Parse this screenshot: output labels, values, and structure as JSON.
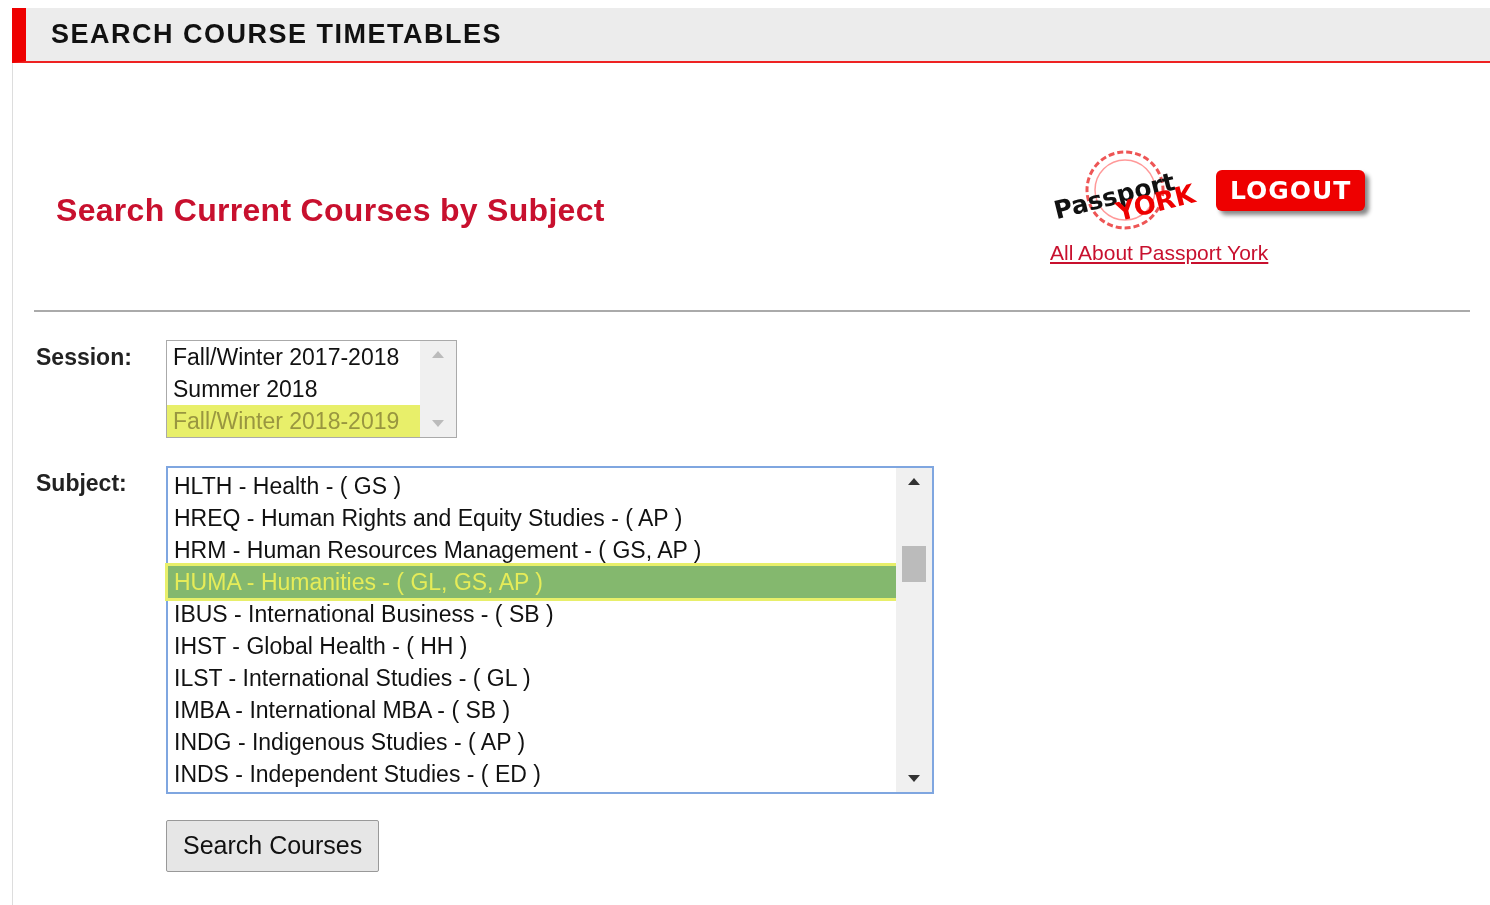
{
  "header": {
    "title": "SEARCH COURSE TIMETABLES"
  },
  "heading": "Search Current Courses by Subject",
  "logo": {
    "line_1": "Passport",
    "line_2": "YORK"
  },
  "logout_button": "LOGOUT",
  "info_link": "All About Passport York",
  "session": {
    "label": "Session:",
    "options": [
      {
        "text": "Fall/Winter 2017-2018",
        "selected": false
      },
      {
        "text": "Summer 2018",
        "selected": false
      },
      {
        "text": "Fall/Winter 2018-2019",
        "selected": true
      }
    ]
  },
  "subject": {
    "label": "Subject:",
    "options": [
      {
        "text": "HLTH - Health - ( GS )",
        "selected": false
      },
      {
        "text": "HREQ - Human Rights and Equity Studies - ( AP )",
        "selected": false
      },
      {
        "text": "HRM - Human Resources Management - ( GS, AP )",
        "selected": false
      },
      {
        "text": "HUMA - Humanities - ( GL, GS, AP )",
        "selected": true
      },
      {
        "text": "IBUS - International Business - ( SB )",
        "selected": false
      },
      {
        "text": "IHST - Global Health - ( HH )",
        "selected": false
      },
      {
        "text": "ILST - International Studies - ( GL )",
        "selected": false
      },
      {
        "text": "IMBA - International MBA - ( SB )",
        "selected": false
      },
      {
        "text": "INDG - Indigenous Studies - ( AP )",
        "selected": false
      },
      {
        "text": "INDS - Independent Studies - ( ED )",
        "selected": false
      }
    ]
  },
  "search_button": "Search Courses"
}
